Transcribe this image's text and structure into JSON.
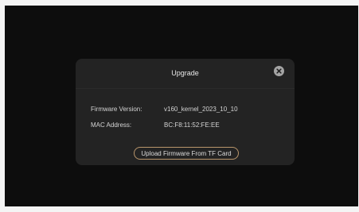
{
  "dialog": {
    "title": "Upgrade",
    "close_icon": "close-circle-icon",
    "firmware": {
      "label": "Firmware Version:",
      "value": "v160_kernel_2023_10_10"
    },
    "mac": {
      "label": "MAC Address:",
      "value": "BC:F8:11:52:FE:EE"
    },
    "upload_button_label": "Upload Firmware From TF Card"
  },
  "colors": {
    "screen_background": "#0d0d0d",
    "dialog_background": "#232323",
    "button_border": "#b8956b",
    "close_icon": "#a5a5a5"
  }
}
